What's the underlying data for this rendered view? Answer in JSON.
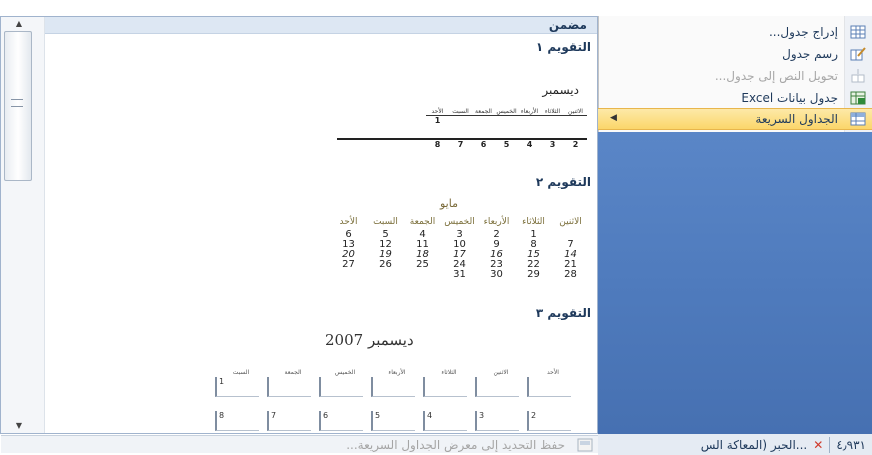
{
  "menu": {
    "items": [
      {
        "label": "إدراج جدول...",
        "icon": "table-grid-icon",
        "disabled": false
      },
      {
        "label": "رسم جدول",
        "icon": "pencil-table-icon",
        "disabled": false
      },
      {
        "label": "تحويل النص إلى جدول...",
        "icon": "text-to-table-icon",
        "disabled": true
      },
      {
        "label": "جدول بيانات Excel",
        "icon": "excel-spreadsheet-icon",
        "disabled": false
      },
      {
        "label": "الجداول السريعة",
        "icon": "quick-tables-icon",
        "disabled": false,
        "active": true
      }
    ]
  },
  "gallery": {
    "header": "مضمن",
    "footer_label": "حفظ التحديد إلى معرض الجداول السريعة...",
    "calendar1": {
      "title": "التقويم ١",
      "month": "ديسمبر",
      "days": [
        "الاثنين",
        "الثلاثاء",
        "الأربعاء",
        "الخميس",
        "الجمعة",
        "السبت",
        "الأحد"
      ],
      "row1": [
        "",
        "",
        "",
        "",
        "",
        "",
        "1"
      ],
      "row2": [
        "2",
        "3",
        "4",
        "5",
        "6",
        "7",
        "8"
      ]
    },
    "calendar2": {
      "title": "التقويم ٢",
      "month": "مايو",
      "days": [
        "الاثنين",
        "الثلاثاء",
        "الأربعاء",
        "الخميس",
        "الجمعة",
        "السبت",
        "الأحد"
      ],
      "rows": [
        [
          "",
          "1",
          "2",
          "3",
          "4",
          "5",
          "6"
        ],
        [
          "7",
          "8",
          "9",
          "10",
          "11",
          "12",
          "13"
        ],
        [
          "14",
          "15",
          "16",
          "17",
          "18",
          "19",
          "20"
        ],
        [
          "21",
          "22",
          "23",
          "24",
          "25",
          "26",
          "27"
        ],
        [
          "28",
          "29",
          "30",
          "31",
          "",
          "",
          ""
        ]
      ]
    },
    "calendar3": {
      "title": "التقويم ٣",
      "heading": "ديسمبر 2007",
      "days": [
        "الأحد",
        "الاثنين",
        "الثلاثاء",
        "الأربعاء",
        "الخميس",
        "الجمعة",
        "السبت"
      ],
      "row1": [
        "",
        "",
        "",
        "",
        "",
        "",
        "1"
      ],
      "row2": [
        "2",
        "3",
        "4",
        "5",
        "6",
        "7",
        "8"
      ]
    }
  },
  "status": {
    "number": "٤٫٩٣١",
    "tab_label": "...الحبر (المعاكة الس"
  }
}
